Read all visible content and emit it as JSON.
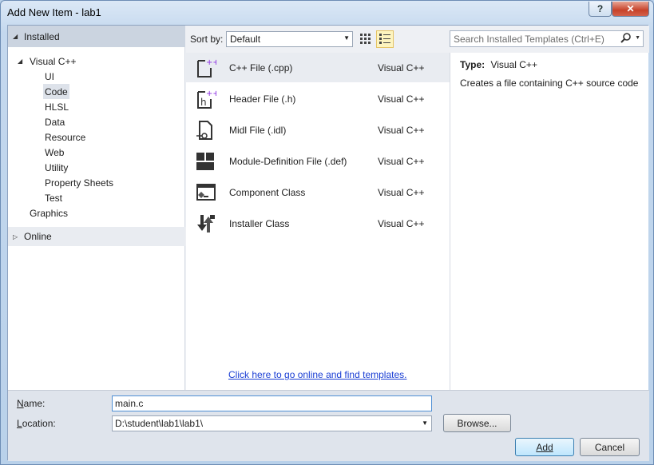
{
  "window": {
    "title": "Add New Item - lab1",
    "help_glyph": "?",
    "close_glyph": "✕"
  },
  "installed": {
    "header": "Installed",
    "tree": [
      {
        "label": "Visual C++"
      },
      {
        "label": "UI"
      },
      {
        "label": "Code",
        "selected": true
      },
      {
        "label": "HLSL"
      },
      {
        "label": "Data"
      },
      {
        "label": "Resource"
      },
      {
        "label": "Web"
      },
      {
        "label": "Utility"
      },
      {
        "label": "Property Sheets"
      },
      {
        "label": "Test"
      },
      {
        "label": "Graphics"
      }
    ],
    "online_header": "Online"
  },
  "sort": {
    "label": "Sort by:",
    "value": "Default"
  },
  "templates": [
    {
      "name": "C++ File (.cpp)",
      "language": "Visual C++",
      "icon": "cpp-file-icon",
      "selected": true
    },
    {
      "name": "Header File (.h)",
      "language": "Visual C++",
      "icon": "header-file-icon"
    },
    {
      "name": "Midl File (.idl)",
      "language": "Visual C++",
      "icon": "midl-file-icon"
    },
    {
      "name": "Module-Definition File (.def)",
      "language": "Visual C++",
      "icon": "module-def-icon"
    },
    {
      "name": "Component Class",
      "language": "Visual C++",
      "icon": "component-class-icon"
    },
    {
      "name": "Installer Class",
      "language": "Visual C++",
      "icon": "installer-class-icon"
    }
  ],
  "online_link": "Click here to go online and find templates.",
  "search": {
    "placeholder": "Search Installed Templates (Ctrl+E)"
  },
  "details": {
    "type_label": "Type:",
    "type_value": "Visual C++",
    "description": "Creates a file containing C++ source code"
  },
  "form": {
    "name_label": "Name:",
    "name_value": "main.c",
    "location_label": "Location:",
    "location_value": "D:\\student\\lab1\\lab1\\",
    "browse_label": "Browse...",
    "add_label": "Add",
    "cancel_label": "Cancel"
  },
  "colors": {
    "accent": "#3c7fb1",
    "link": "#1a3ed4",
    "selection": "#e9ecf1"
  }
}
